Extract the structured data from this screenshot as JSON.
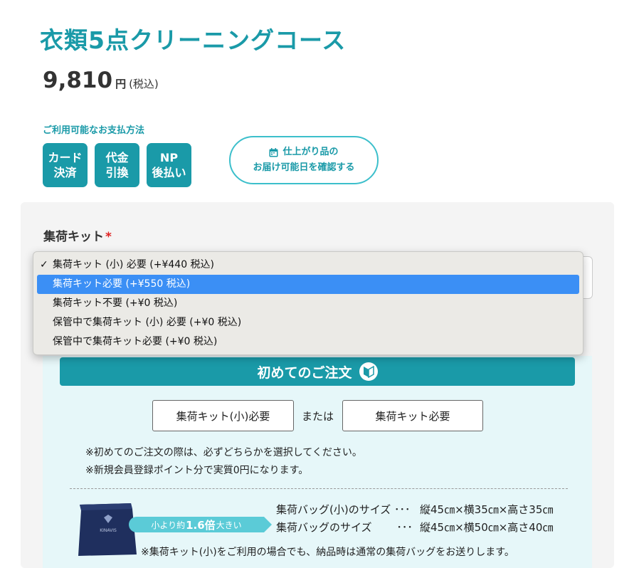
{
  "product": {
    "title": "衣類5点クリーニングコース",
    "price": "9,810",
    "currency": "円",
    "tax_note": "(税込)"
  },
  "payment": {
    "heading": "ご利用可能なお支払方法",
    "methods": [
      {
        "label": "カード\n決済"
      },
      {
        "label": "代金\n引換"
      },
      {
        "label": "NP\n後払い"
      }
    ]
  },
  "delivery_button": {
    "line1": "仕上がり品の",
    "line2": "お届け可能日を確認する",
    "icon": "calendar-icon"
  },
  "kit_field": {
    "label": "集荷キット",
    "required_mark": "*",
    "options": [
      {
        "label": "集荷キット (小) 必要 (+¥440 税込)",
        "checked": true
      },
      {
        "label": "集荷キット必要 (+¥550 税込)",
        "highlighted": true
      },
      {
        "label": "集荷キット不要 (+¥0 税込)"
      },
      {
        "label": "保管中で集荷キット (小) 必要 (+¥0 税込)"
      },
      {
        "label": "保管中で集荷キット必要 (+¥0 税込)"
      }
    ]
  },
  "first_order": {
    "banner": "初めてのご注文",
    "option_a": "集荷キット(小)必要",
    "or": "または",
    "option_b": "集荷キット必要",
    "note1": "※初めてのご注文の際は、必ずどちらかを選択してください。",
    "note2": "※新規会員登録ポイント分で実質0円になります。"
  },
  "bag_info": {
    "compare_prefix": "小より約",
    "compare_value": "1.6倍",
    "compare_suffix": "大きい",
    "bag_brand": "KINAVIS",
    "small_name": "集荷バッグ(小)のサイズ ･･･",
    "small_spec": "縦45㎝×横35㎝×高さ35㎝",
    "large_name": "集荷バッグのサイズ　　 ･･･",
    "large_spec": "縦45㎝×横50㎝×高さ40㎝",
    "footnote": "※集荷キット(小)をご利用の場合でも、納品時は通常の集荷バッグをお送りします。"
  },
  "colors": {
    "accent": "#1a9aa8",
    "highlight": "#3b8ff5",
    "required": "#e02020"
  }
}
